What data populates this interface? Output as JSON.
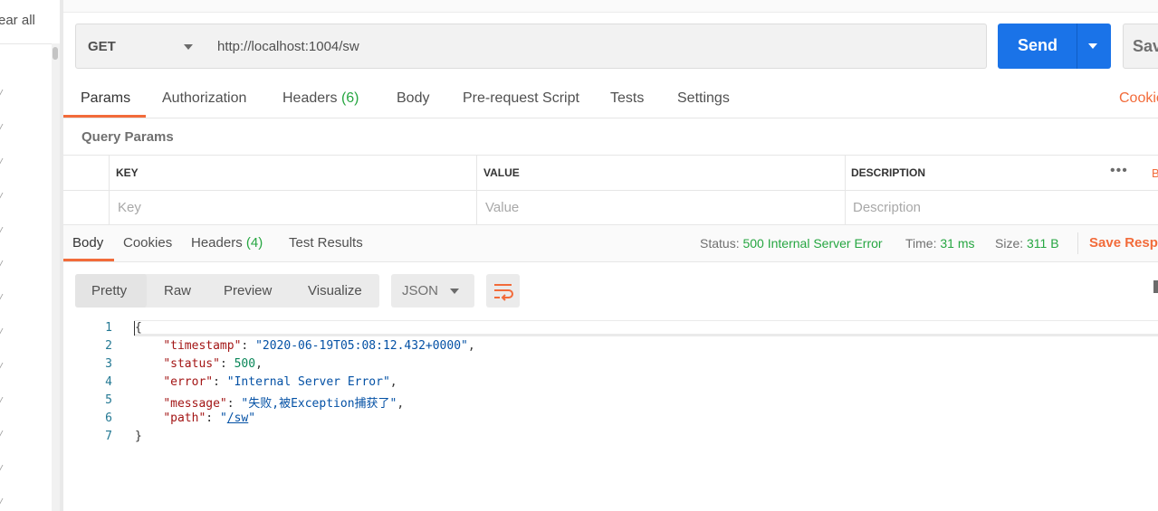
{
  "sidebar": {
    "clear_label": "ear all"
  },
  "request": {
    "method": "GET",
    "url": "http://localhost:1004/sw",
    "send_label": "Send",
    "save_label": "Sav"
  },
  "request_tabs": {
    "params": "Params",
    "authorization": "Authorization",
    "headers": "Headers",
    "headers_count": "(6)",
    "body": "Body",
    "prerequest": "Pre-request Script",
    "tests": "Tests",
    "settings": "Settings",
    "cookies": "Cookie"
  },
  "query_params": {
    "title": "Query Params",
    "columns": [
      "KEY",
      "VALUE",
      "DESCRIPTION"
    ],
    "placeholders": [
      "Key",
      "Value",
      "Description"
    ],
    "bulk_edit": "B"
  },
  "response_tabs": {
    "body": "Body",
    "cookies": "Cookies",
    "headers": "Headers",
    "headers_count": "(4)",
    "test_results": "Test Results"
  },
  "response_meta": {
    "status_label": "Status:",
    "status_value": "500 Internal Server Error",
    "time_label": "Time:",
    "time_value": "31 ms",
    "size_label": "Size:",
    "size_value": "311 B",
    "save_response": "Save Respo"
  },
  "body_view": {
    "modes": [
      "Pretty",
      "Raw",
      "Preview",
      "Visualize"
    ],
    "format": "JSON"
  },
  "code": {
    "line_numbers": [
      "1",
      "2",
      "3",
      "4",
      "5",
      "6",
      "7"
    ],
    "open_brace": "{",
    "close_brace": "}",
    "fields": [
      {
        "key": "\"timestamp\"",
        "value": "\"2020-06-19T05:08:12.432+0000\"",
        "type": "string"
      },
      {
        "key": "\"status\"",
        "value": "500",
        "type": "number"
      },
      {
        "key": "\"error\"",
        "value": "\"Internal Server Error\"",
        "type": "string"
      },
      {
        "key": "\"message\"",
        "value": "\"失败,被Exception捕获了\"",
        "type": "string"
      },
      {
        "key": "\"path\"",
        "value_open": "\"",
        "value_link": "/sw",
        "value_close": "\"",
        "type": "link"
      }
    ]
  }
}
